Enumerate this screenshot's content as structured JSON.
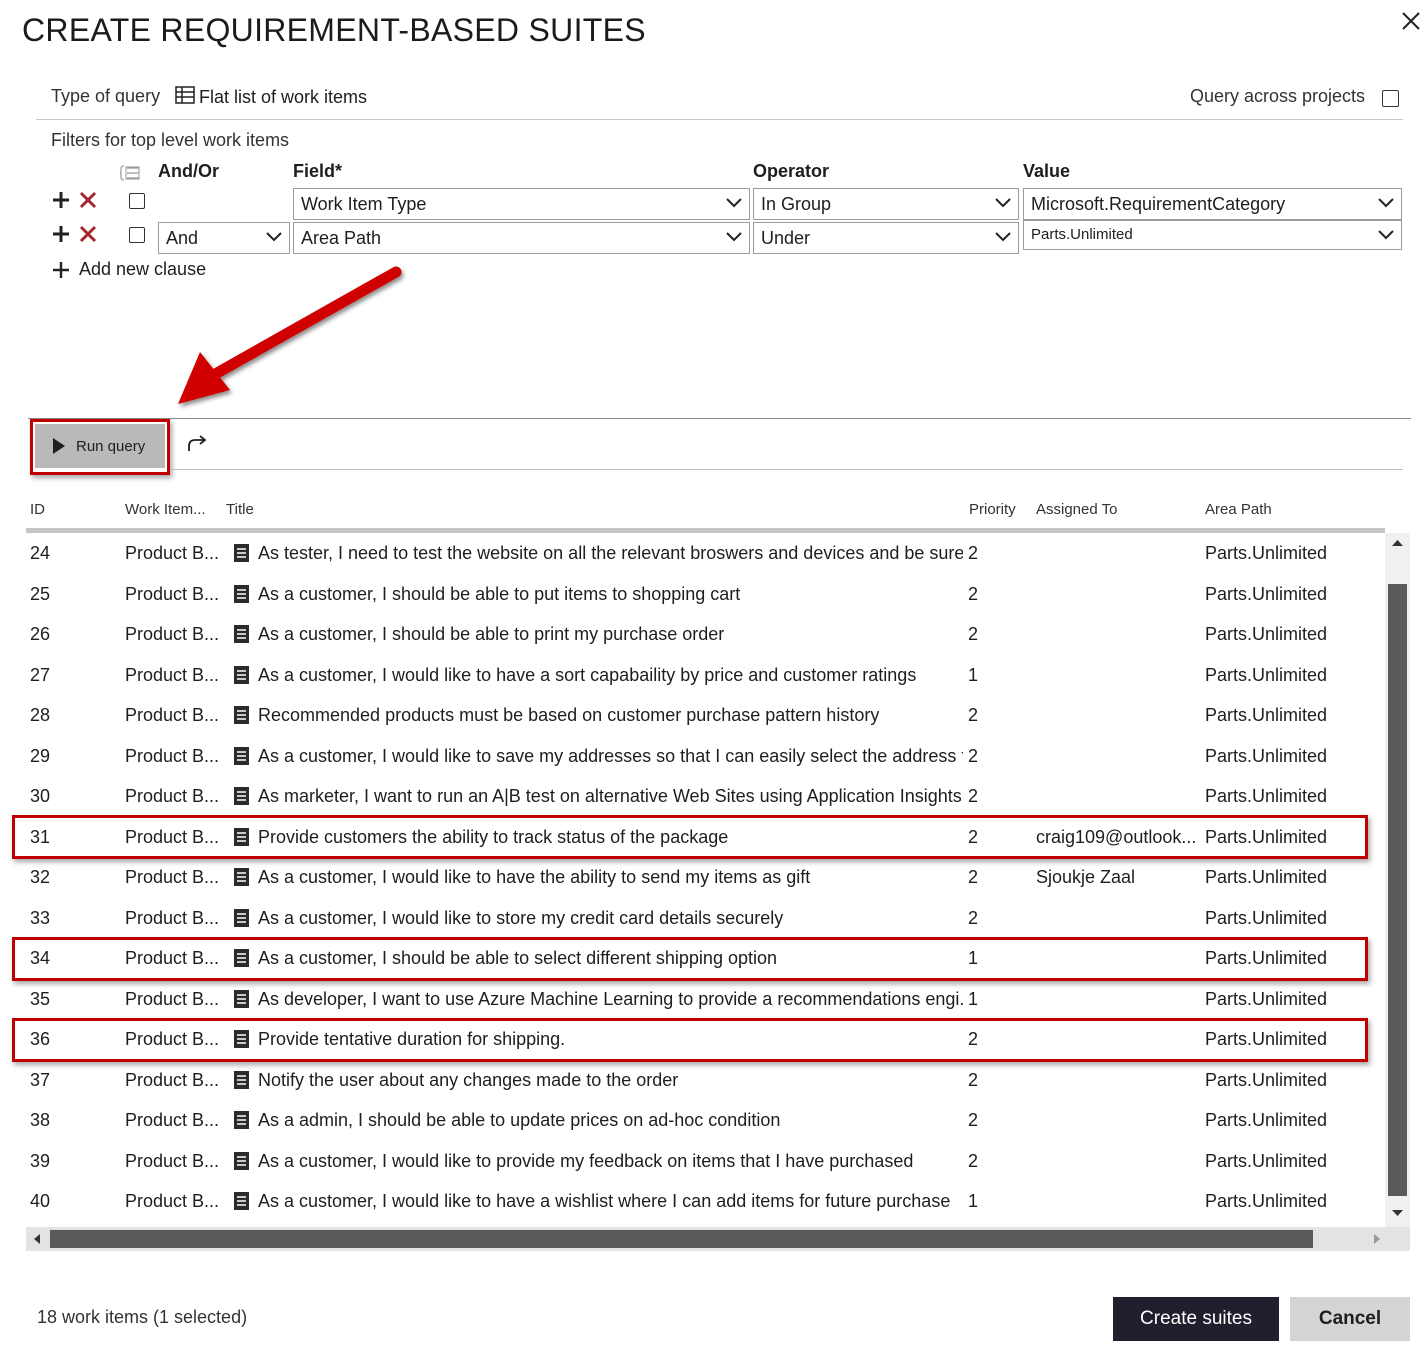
{
  "dialog": {
    "title": "CREATE REQUIREMENT-BASED SUITES"
  },
  "query": {
    "type_label": "Type of query",
    "type_value": "Flat list of work items",
    "across_projects_label": "Query across projects",
    "across_projects_checked": false
  },
  "filters": {
    "label": "Filters for top level work items",
    "columns": {
      "andor": "And/Or",
      "field": "Field*",
      "operator": "Operator",
      "value": "Value"
    },
    "clauses": [
      {
        "andor": "",
        "field": "Work Item Type",
        "operator": "In Group",
        "value": "Microsoft.RequirementCategory"
      },
      {
        "andor": "And",
        "field": "Area Path",
        "operator": "Under",
        "value": "Parts.Unlimited"
      }
    ],
    "add_clause_label": "Add new clause"
  },
  "toolbar": {
    "run_query_label": "Run query"
  },
  "grid": {
    "headers": {
      "id": "ID",
      "type": "Work Item...",
      "title": "Title",
      "priority": "Priority",
      "assigned": "Assigned To",
      "area": "Area Path"
    },
    "rows": [
      {
        "id": "24",
        "type": "Product B...",
        "title": "As tester, I need to test the website on all the relevant broswers and devices and be sure ...",
        "priority": "2",
        "assigned": "",
        "area": "Parts.Unlimited"
      },
      {
        "id": "25",
        "type": "Product B...",
        "title": "As a customer, I should be able to put items to shopping cart",
        "priority": "2",
        "assigned": "",
        "area": "Parts.Unlimited"
      },
      {
        "id": "26",
        "type": "Product B...",
        "title": "As a customer, I should be able to print my purchase order",
        "priority": "2",
        "assigned": "",
        "area": "Parts.Unlimited"
      },
      {
        "id": "27",
        "type": "Product B...",
        "title": "As a customer, I would like to have a sort capabaility by price and customer ratings",
        "priority": "1",
        "assigned": "",
        "area": "Parts.Unlimited"
      },
      {
        "id": "28",
        "type": "Product B...",
        "title": "Recommended products must be based on customer purchase pattern history",
        "priority": "2",
        "assigned": "",
        "area": "Parts.Unlimited"
      },
      {
        "id": "29",
        "type": "Product B...",
        "title": "As a customer, I would like to save my addresses so that I can easily select the address fo...",
        "priority": "2",
        "assigned": "",
        "area": "Parts.Unlimited"
      },
      {
        "id": "30",
        "type": "Product B...",
        "title": "As marketer, I want to run an A|B test on alternative Web Sites using Application Insights.",
        "priority": "2",
        "assigned": "",
        "area": "Parts.Unlimited"
      },
      {
        "id": "31",
        "type": "Product B...",
        "title": "Provide customers the ability to track status of the package",
        "priority": "2",
        "assigned": "craig109@outlook...",
        "area": "Parts.Unlimited"
      },
      {
        "id": "32",
        "type": "Product B...",
        "title": "As a customer, I would like to have the ability to send my items as gift",
        "priority": "2",
        "assigned": "Sjoukje Zaal",
        "area": "Parts.Unlimited"
      },
      {
        "id": "33",
        "type": "Product B...",
        "title": "As a customer, I would like to store my credit card details securely",
        "priority": "2",
        "assigned": "",
        "area": "Parts.Unlimited"
      },
      {
        "id": "34",
        "type": "Product B...",
        "title": "As a customer, I should be able to select different shipping option",
        "priority": "1",
        "assigned": "",
        "area": "Parts.Unlimited"
      },
      {
        "id": "35",
        "type": "Product B...",
        "title": "As developer, I want to use Azure Machine Learning to provide a recommendations engi...",
        "priority": "1",
        "assigned": "",
        "area": "Parts.Unlimited"
      },
      {
        "id": "36",
        "type": "Product B...",
        "title": "Provide tentative duration for shipping.",
        "priority": "2",
        "assigned": "",
        "area": "Parts.Unlimited"
      },
      {
        "id": "37",
        "type": "Product B...",
        "title": "Notify the user about any changes made to the order",
        "priority": "2",
        "assigned": "",
        "area": "Parts.Unlimited"
      },
      {
        "id": "38",
        "type": "Product B...",
        "title": "As a admin, I should be able to update prices on ad-hoc condition",
        "priority": "2",
        "assigned": "",
        "area": "Parts.Unlimited"
      },
      {
        "id": "39",
        "type": "Product B...",
        "title": "As a customer, I would like to provide my feedback on items that I have purchased",
        "priority": "2",
        "assigned": "",
        "area": "Parts.Unlimited"
      },
      {
        "id": "40",
        "type": "Product B...",
        "title": "As a customer, I would like to have a wishlist where I can add items for future purchase",
        "priority": "1",
        "assigned": "",
        "area": "Parts.Unlimited"
      }
    ]
  },
  "footer": {
    "count_text": "18 work items (1 selected)",
    "create_label": "Create suites",
    "cancel_label": "Cancel"
  },
  "icons": {
    "close": "close-icon",
    "grid": "grid-list-icon",
    "add": "plus-icon",
    "remove": "red-x-icon",
    "group": "group-clauses-icon",
    "chevron": "chevron-down-icon",
    "play": "play-icon",
    "redo": "redo-arrow-icon",
    "work_item": "backlog-item-icon",
    "annotation_arrow": "red-annotation-arrow"
  },
  "colors": {
    "highlight": "#c00000",
    "remove_icon": "#a4262c",
    "primary_button": "#1f1f2e",
    "run_button": "#b9b9b9"
  }
}
